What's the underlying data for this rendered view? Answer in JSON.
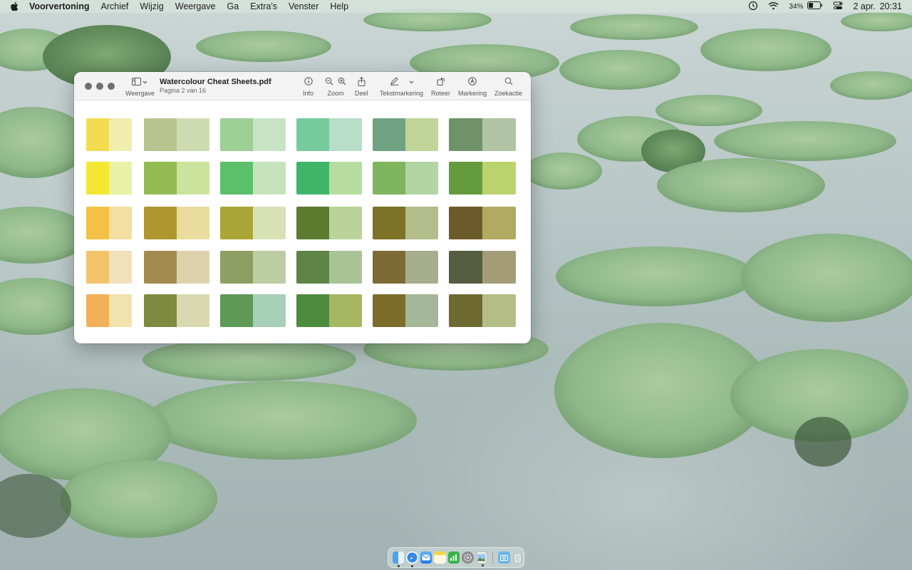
{
  "menubar": {
    "apple_icon": "apple-logo-icon",
    "items": [
      "Voorvertoning",
      "Archief",
      "Wijzig",
      "Weergave",
      "Ga",
      "Extra's",
      "Venster",
      "Help"
    ],
    "battery_percent": "34%",
    "date": "2 apr.",
    "time": "20:31"
  },
  "window": {
    "title": "Watercolour Cheat Sheets.pdf",
    "subtitle": "Pagina 2 van 16",
    "toolbar": {
      "view": "Weergave",
      "info": "Info",
      "zoom": "Zoom",
      "share": "Deel",
      "markup_text": "Tekstmarkering",
      "rotate": "Roteer",
      "markup": "Markering",
      "search": "Zoekactie"
    },
    "swatch_rows": [
      [
        [
          "#f3dc52",
          "#f1ecb0"
        ],
        [
          "#b8c48e",
          "#cfdcb1"
        ],
        [
          "#9dcf97",
          "#c7e3c4"
        ],
        [
          "#75cb9c",
          "#b8ddc8"
        ],
        [
          "#6fa281",
          "#c0d597"
        ],
        [
          "#6f9269",
          "#b0c3a5"
        ]
      ],
      [
        [
          "#f3e732",
          "#e9f1a6"
        ],
        [
          "#92bc52",
          "#cbe39d"
        ],
        [
          "#5cbf6a",
          "#c4e3bb"
        ],
        [
          "#3fb56a",
          "#b6dc9e"
        ],
        [
          "#7fb55e",
          "#b2d5a3"
        ],
        [
          "#649b3d",
          "#bbd36d"
        ]
      ],
      [
        [
          "#f4c046",
          "#f3dfa1"
        ],
        [
          "#b0962f",
          "#e9dc9e"
        ],
        [
          "#a9a637",
          "#d8e0b6"
        ],
        [
          "#5b7b2f",
          "#b9d39a"
        ],
        [
          "#7c7328",
          "#b2bd8b"
        ],
        [
          "#6d5a2a",
          "#b3aa62"
        ]
      ],
      [
        [
          "#f2c36a",
          "#f1e0b9"
        ],
        [
          "#a38b4f",
          "#ddd2ab"
        ],
        [
          "#8f9f63",
          "#bccca3"
        ],
        [
          "#5e8446",
          "#a8c497"
        ],
        [
          "#7d6a34",
          "#a5ae8c"
        ],
        [
          "#545d3f",
          "#a49b77"
        ]
      ],
      [
        [
          "#f1b057",
          "#f2e2ae"
        ],
        [
          "#7d8a40",
          "#d8d9b0"
        ],
        [
          "#5e9a56",
          "#a7cfb7"
        ],
        [
          "#4d8b3d",
          "#a7b661"
        ],
        [
          "#7c6d2a",
          "#a4b798"
        ],
        [
          "#6e6a2f",
          "#b5bd87"
        ]
      ]
    ]
  },
  "dock": {
    "icons": [
      "finder-icon",
      "safari-icon",
      "mail-icon",
      "notes-icon",
      "numbers-icon",
      "system-settings-icon",
      "preview-icon",
      "screenshot-folder-icon",
      "trash-icon"
    ]
  }
}
